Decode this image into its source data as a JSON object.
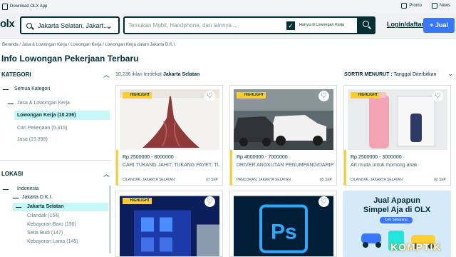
{
  "topbar": {
    "download": "Download OLX App",
    "promo": "Promo",
    "news": "News"
  },
  "header": {
    "logo": "olx",
    "location_value": "Jakarta Selatan, Jakart...",
    "search_placeholder": "Temukan Mobil, Handphone, dan lainnya ...",
    "checkbox_label": "Hanya di Lowongan Kerja",
    "login": "Login/daftar",
    "sell": "+ Jual"
  },
  "breadcrumb": [
    "Beranda",
    "Jasa & Lowongan Kerja",
    "Lowongan Kerja",
    "Lowongan Kerja dalam Jakarta D.K.I."
  ],
  "page_title": "Info Lowongan Pekerjaan Terbaru",
  "results": {
    "count": "10.236 iklan terdekat",
    "place": "Jakarta Selatan"
  },
  "sort": {
    "label": "SORTIR MENURUT :",
    "value": "Tanggal Diterbitkan"
  },
  "sidebar": {
    "kategori_title": "KATEGORI",
    "categories": [
      "Semua Kategori",
      "Jasa & Lowongan Kerja",
      "Lowongan Kerja (10.236)",
      "Cari Pekerjaan (5.315)",
      "Jasa (15.398)"
    ],
    "lokasi_title": "LOKASI",
    "locations": [
      "Indonesia",
      "Jakarta D.K.I.",
      "Jakarta Selatan",
      "Cilandak (154)",
      "Kebayoran Baru (150)",
      "Setia Budi (147)",
      "Kebayoran Lama (145)"
    ]
  },
  "listings": [
    {
      "badge": "HIGHLIGHT",
      "price": "Rp 2500000 - 8000000",
      "desc": "CARI TUKANG JAHIT, TUKANG PAYET, TU...",
      "location": "CILANDAK, JAKARTA SELATAN",
      "date": "07 SEP"
    },
    {
      "badge": "HIGHLIGHT",
      "price": "Rp 4000000 - 7000000",
      "desc": "DRIVER ANGKUTAN PENUMPANG/DARIP...",
      "location": "PANCORAN, JAKARTA SELATAN",
      "date": "05 SEP"
    },
    {
      "badge": "HIGHLIGHT",
      "price": "Rp 2500000 - 3000000",
      "desc": "Art muda untuk momong anak",
      "location": "CILANDAK, JAKARTA SELATAN",
      "date": "02 SEP"
    },
    {
      "badge": "HIGHLIGHT"
    },
    {}
  ],
  "promo": {
    "line1": "Jual Apapun",
    "line2": "Simpel Aja di OLX",
    "cta": "Cek Sekarang"
  },
  "watermark": "KOMPTIK",
  "colors": {
    "accent": "#3a77ff",
    "brand": "#002f34",
    "highlight": "#ffce32",
    "selected": "#c8f8f6"
  }
}
